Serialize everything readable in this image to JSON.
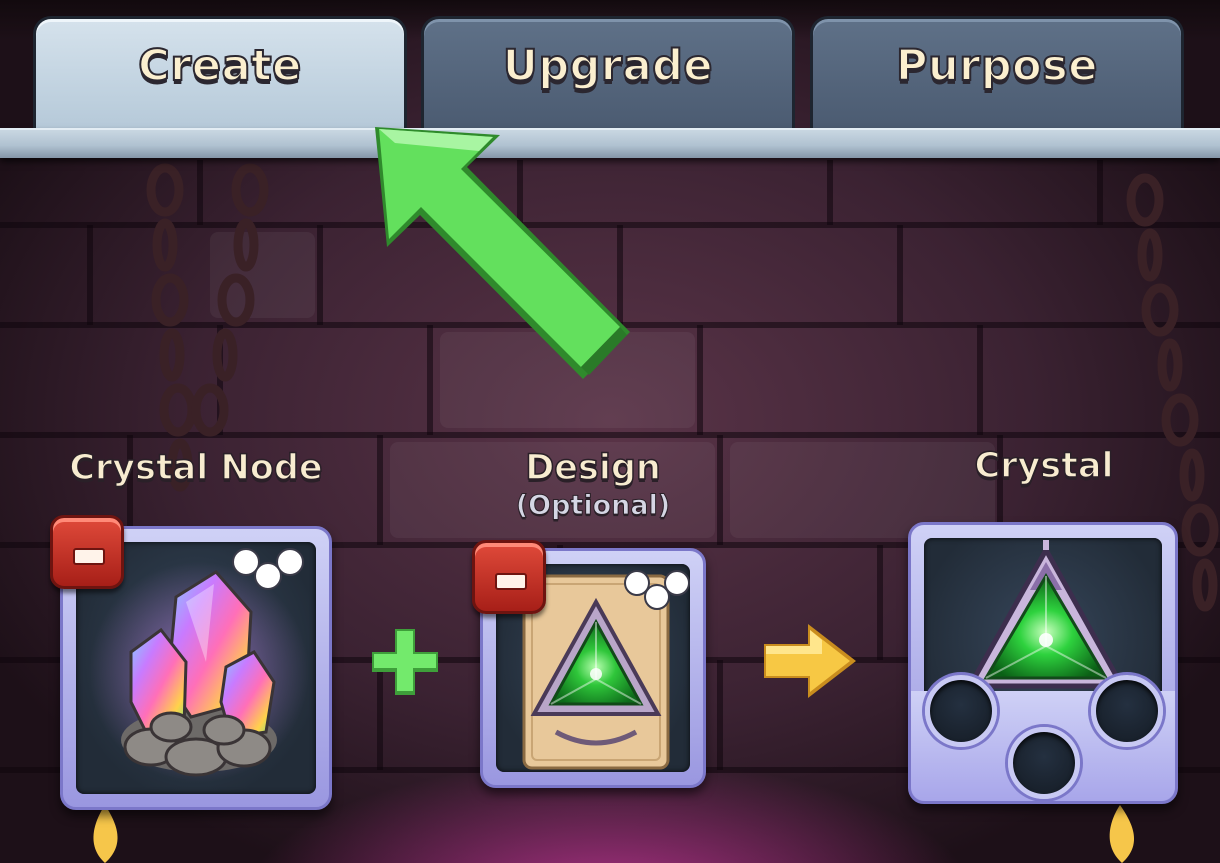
{
  "tabs": [
    {
      "label": "Create",
      "active": true
    },
    {
      "label": "Upgrade",
      "active": false
    },
    {
      "label": "Purpose",
      "active": false
    }
  ],
  "slots": {
    "crystal_node": {
      "label": "Crystal Node",
      "icon": "rainbow-crystal-cluster-icon"
    },
    "design": {
      "label": "Design",
      "sublabel": "(Optional)",
      "icon": "triangle-design-scroll-icon"
    },
    "crystal": {
      "label": "Crystal",
      "icon": "green-triangle-crystal-icon",
      "socket_count": 3
    }
  },
  "operators": {
    "plus": "plus-icon",
    "arrow": "right-arrow-icon"
  },
  "tutorial_pointer": "green-pointer-arrow-icon",
  "colors": {
    "tab_active": "#c3d4e2",
    "tab_inactive": "#54657c",
    "label_text": "#f8ecd0",
    "minus_button": "#c9342a",
    "slot_frame": "#b4b3ee",
    "pointer_green": "#5fe05a",
    "plus_green": "#6ee86a",
    "arrow_yellow": "#f4c33c"
  }
}
